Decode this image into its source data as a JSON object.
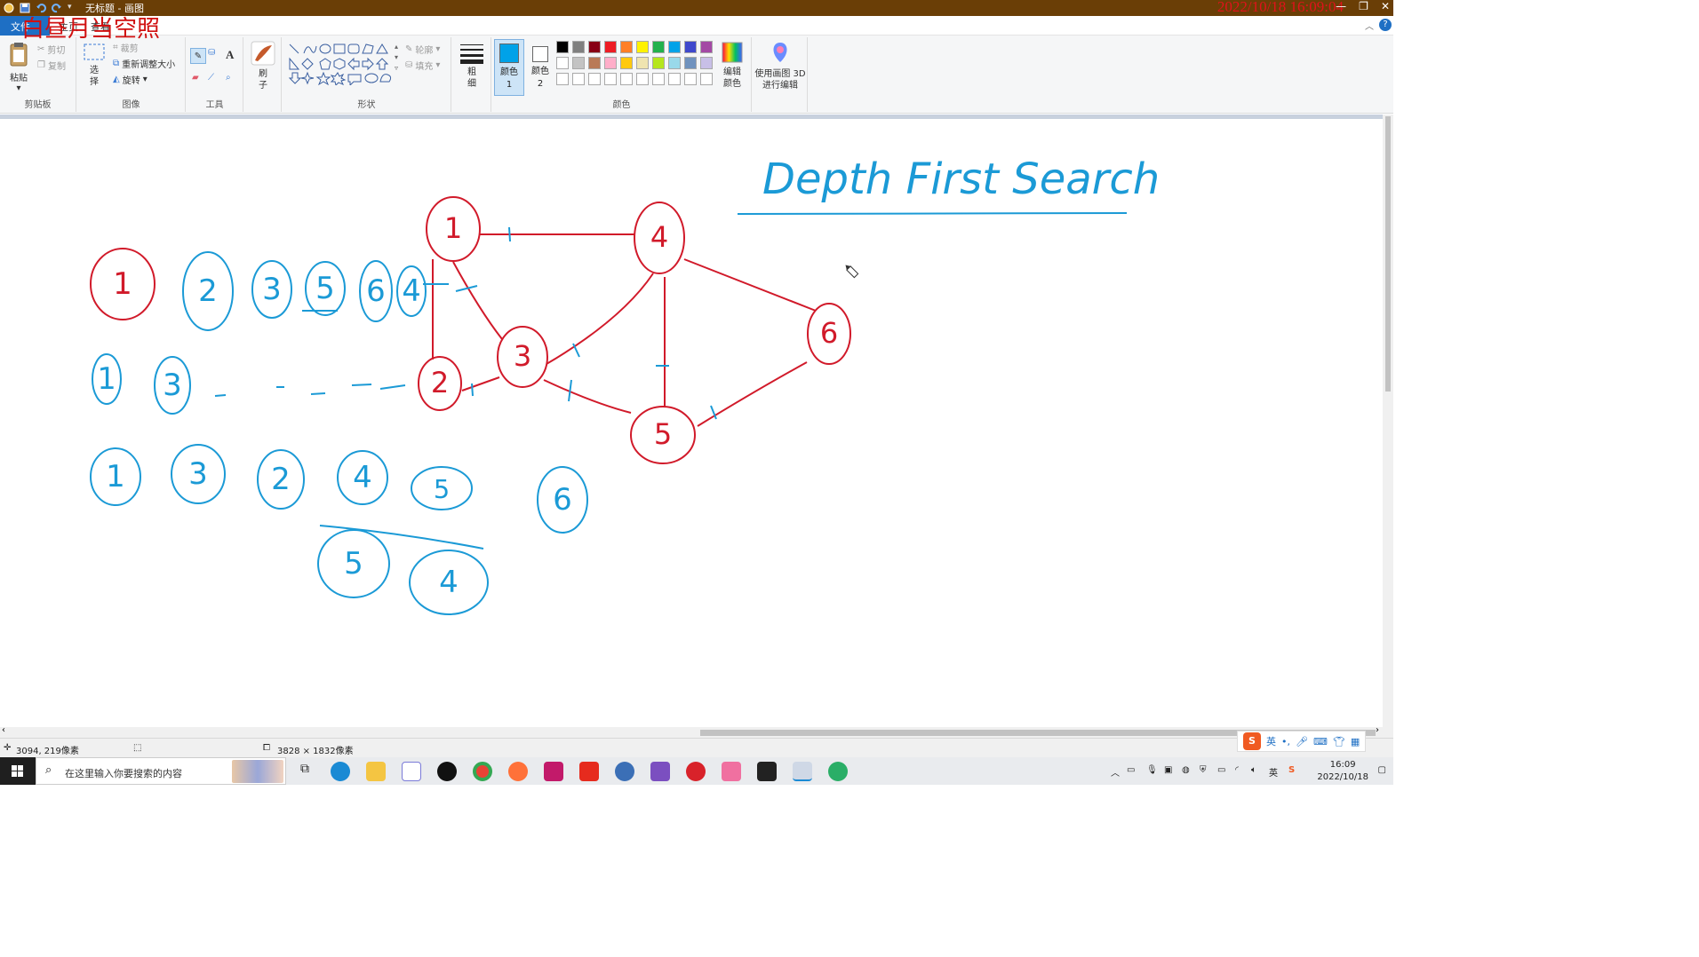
{
  "titlebar": {
    "title": "无标题 - 画图",
    "timestamp_overlay": "2022/10/18 16:09:04",
    "watermark": "白昼月当空照"
  },
  "menu": {
    "file": "文件",
    "home": "主页",
    "view": "查看"
  },
  "ribbon": {
    "clipboard": {
      "label": "剪贴板",
      "paste": "粘贴",
      "cut": "剪切",
      "copy": "复制"
    },
    "image": {
      "label": "图像",
      "select": "选择",
      "crop": "裁剪",
      "resize": "重新调整大小",
      "rotate": "旋转"
    },
    "tools": {
      "label": "工具"
    },
    "brushes": {
      "label": "刷子"
    },
    "shapes": {
      "label": "形状",
      "outline": "轮廓",
      "fill": "填充"
    },
    "size": {
      "label": "粗细"
    },
    "colors": {
      "label": "颜色",
      "color1": "颜色 1",
      "color2": "颜色 2",
      "color1_value": "#00a2e8",
      "color2_value": "#ffffff",
      "edit": "编辑颜色",
      "palette_row1": [
        "#000000",
        "#7f7f7f",
        "#880015",
        "#ed1c24",
        "#ff7f27",
        "#fff200",
        "#22b14c",
        "#00a2e8",
        "#3f48cc",
        "#a349a4"
      ],
      "palette_row2": [
        "#ffffff",
        "#c3c3c3",
        "#b97a57",
        "#ffaec9",
        "#ffc90e",
        "#efe4b0",
        "#b5e61d",
        "#99d9ea",
        "#7092be",
        "#c8bfe7"
      ],
      "palette_row3": [
        "#ffffff",
        "#ffffff",
        "#ffffff",
        "#ffffff",
        "#ffffff",
        "#ffffff",
        "#ffffff",
        "#ffffff",
        "#ffffff",
        "#ffffff"
      ]
    },
    "paint3d": "使用画图 3D 进行编辑"
  },
  "canvas": {
    "heading": "Depth First Search",
    "graph_nodes": [
      "1",
      "4",
      "3",
      "2",
      "5",
      "6"
    ],
    "row1": [
      "1",
      "2",
      "3",
      "5",
      "6",
      "4"
    ],
    "row2": [
      "1",
      "3"
    ],
    "row3": [
      "1",
      "3",
      "2",
      "4",
      "5",
      "6"
    ],
    "row4": [
      "5",
      "4"
    ],
    "ink_red": "#d11a2a",
    "ink_blue": "#1b9ad6"
  },
  "status": {
    "cursor": "3094, 219像素",
    "size": "3828 × 1832像素"
  },
  "ime": {
    "mode": "英"
  },
  "taskbar": {
    "search_placeholder": "在这里输入你要搜索的内容",
    "lang": "英",
    "time": "16:09",
    "date": "2022/10/18"
  }
}
